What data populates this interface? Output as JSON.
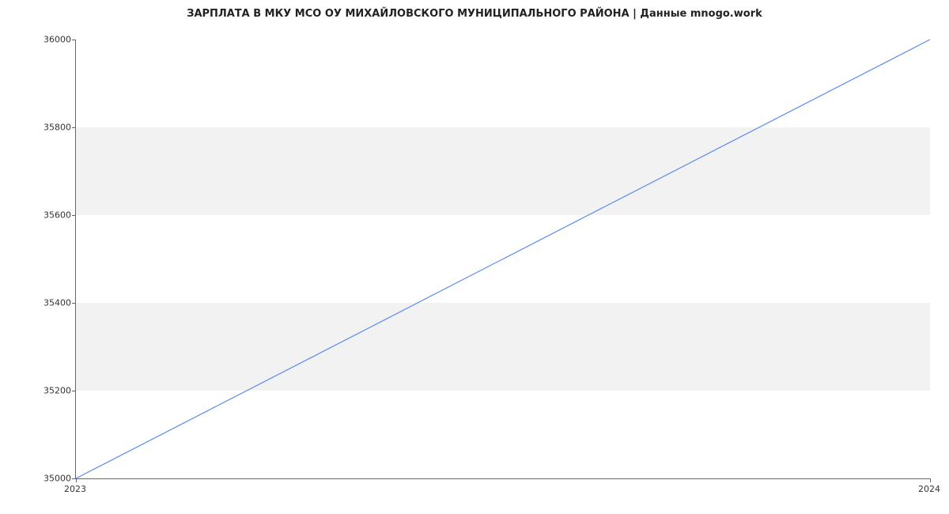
{
  "chart_data": {
    "type": "line",
    "title": "ЗАРПЛАТА В МКУ МСО ОУ МИХАЙЛОВСКОГО МУНИЦИПАЛЬНОГО РАЙОНА | Данные mnogo.work",
    "x": [
      2023,
      2024
    ],
    "y": [
      35000,
      36000
    ],
    "xlabel": "",
    "ylabel": "",
    "xlim": [
      2023,
      2024
    ],
    "ylim": [
      35000,
      36000
    ],
    "xticks": [
      2023,
      2024
    ],
    "yticks": [
      35000,
      35200,
      35400,
      35600,
      35800,
      36000
    ],
    "xtick_labels": [
      "2023",
      "2024"
    ],
    "ytick_labels": [
      "35000",
      "35200",
      "35400",
      "35600",
      "35800",
      "36000"
    ],
    "line_color": "#5b8def",
    "stripe_color": "#f2f2f2",
    "stripes": [
      {
        "y0": 35200,
        "y1": 35400
      },
      {
        "y0": 35600,
        "y1": 35800
      }
    ]
  }
}
